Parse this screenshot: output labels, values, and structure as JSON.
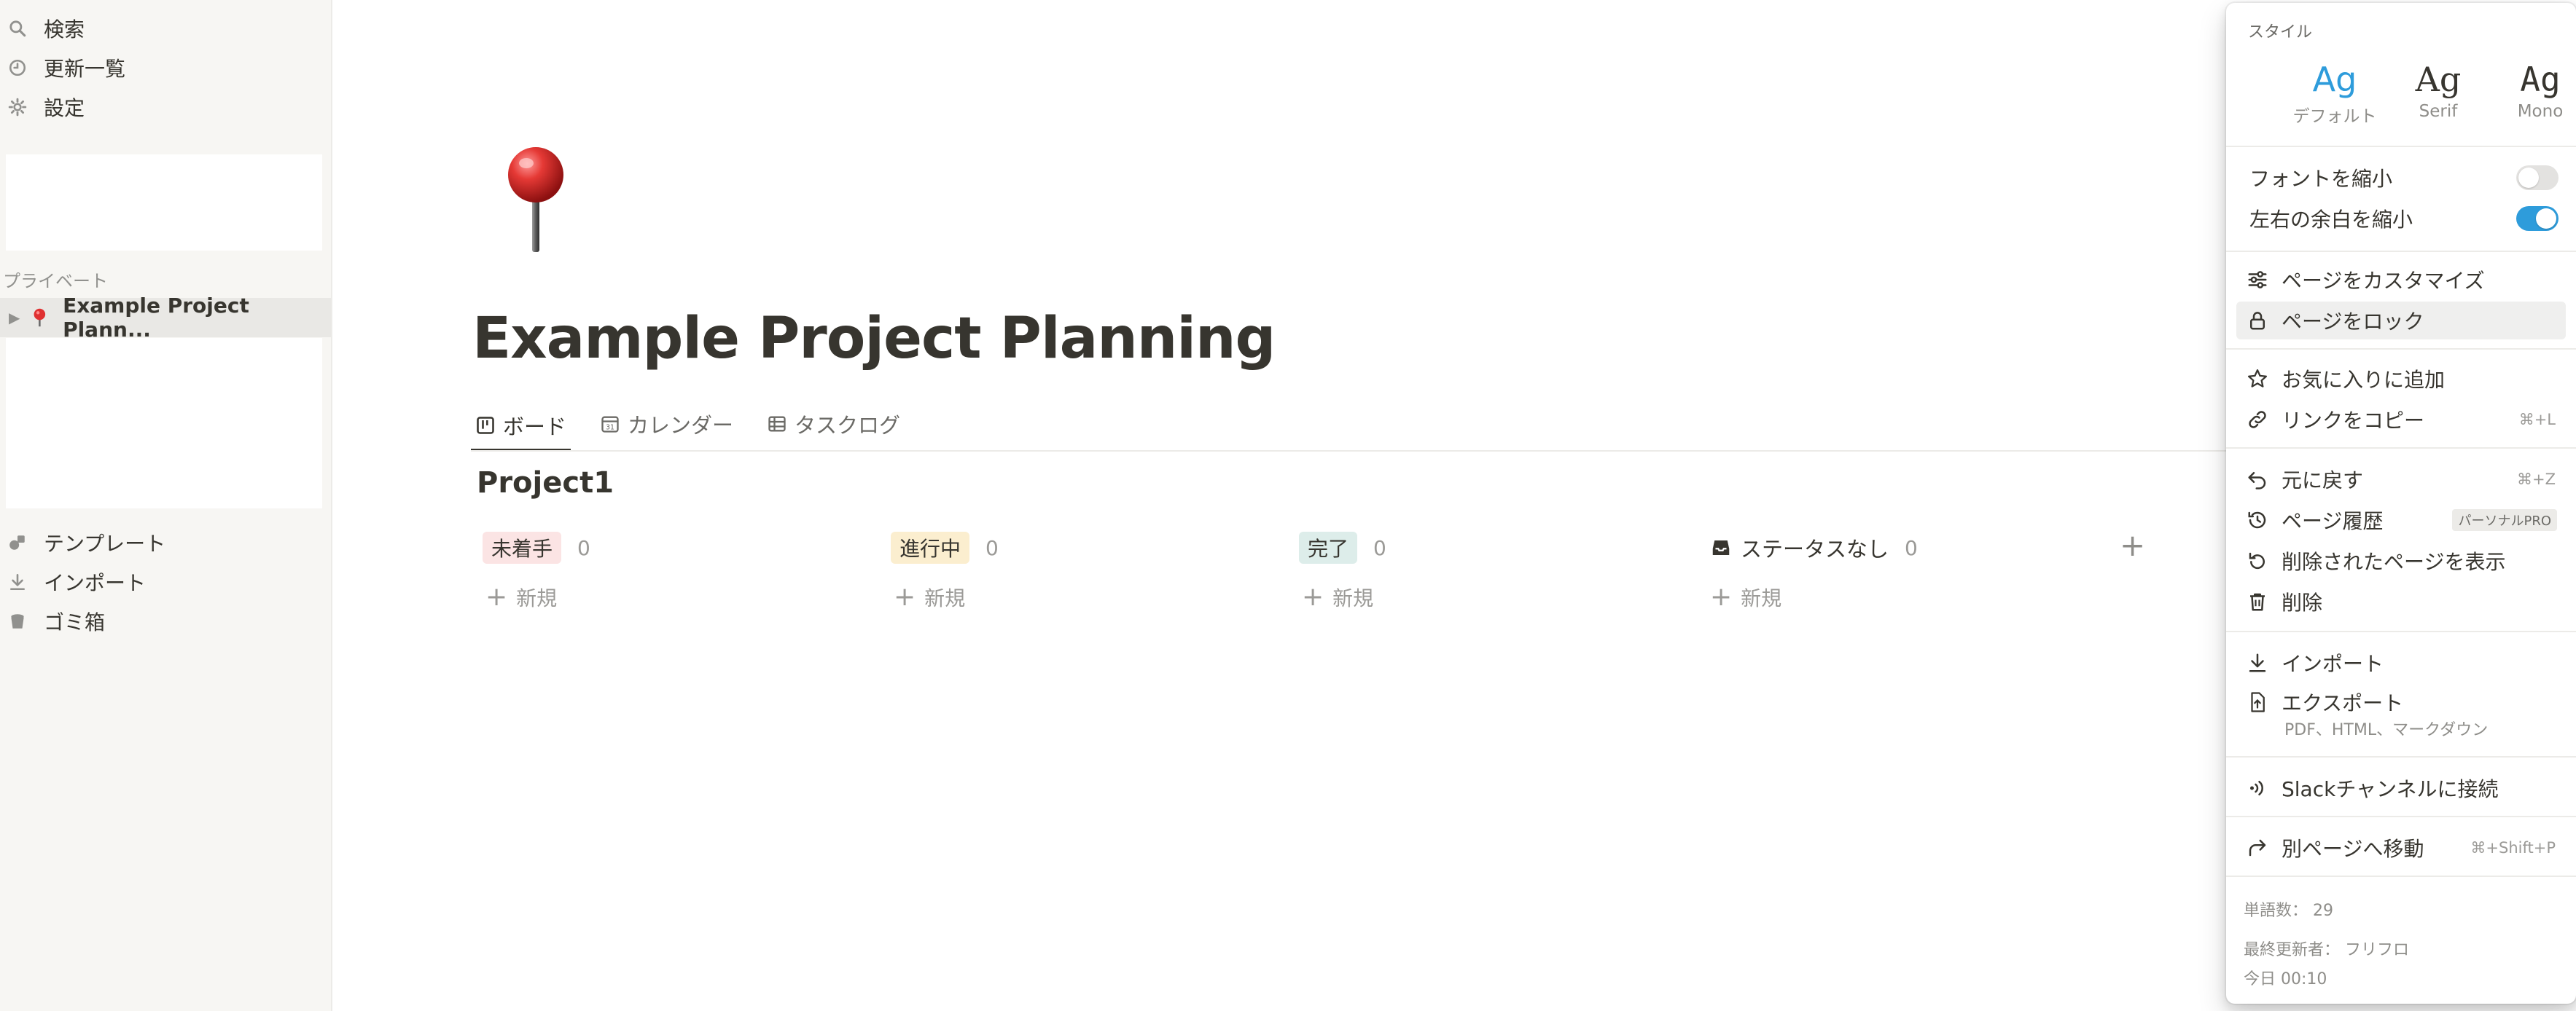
{
  "sidebar": {
    "top_items": [
      {
        "label": "検索",
        "icon": "search-icon"
      },
      {
        "label": "更新一覧",
        "icon": "clock-icon"
      },
      {
        "label": "設定",
        "icon": "gear-icon"
      }
    ],
    "section_label": "プライベート",
    "page": {
      "label": "Example Project Plann...",
      "icon": "pushpin-icon"
    },
    "bottom_items": [
      {
        "label": "テンプレート",
        "icon": "shapes-icon"
      },
      {
        "label": "インポート",
        "icon": "import-icon"
      },
      {
        "label": "ゴミ箱",
        "icon": "trash-icon"
      }
    ]
  },
  "page": {
    "icon": "pushpin-icon",
    "title": "Example Project Planning",
    "tabs": [
      {
        "label": "ボード",
        "icon": "board-icon",
        "active": true
      },
      {
        "label": "カレンダー",
        "icon": "calendar-icon",
        "active": false
      },
      {
        "label": "タスクログ",
        "icon": "table-icon",
        "active": false
      }
    ],
    "group_title": "Project1",
    "columns": [
      {
        "label": "未着手",
        "count": "0",
        "bg": "#fbe4e4",
        "new_label": "新規"
      },
      {
        "label": "進行中",
        "count": "0",
        "bg": "#fbeecf",
        "new_label": "新規"
      },
      {
        "label": "完了",
        "count": "0",
        "bg": "#ddedea",
        "new_label": "新規"
      },
      {
        "label": "ステータスなし",
        "count": "0",
        "icon": "inbox-icon",
        "new_label": "新規"
      }
    ],
    "add_column": "+"
  },
  "menu": {
    "style_label": "スタイル",
    "styles": [
      {
        "sample": "Ag",
        "label": "デフォルト",
        "selected": true
      },
      {
        "sample": "Ag",
        "label": "Serif",
        "selected": false
      },
      {
        "sample": "Ag",
        "label": "Mono",
        "selected": false
      }
    ],
    "toggles": [
      {
        "label": "フォントを縮小",
        "on": false
      },
      {
        "label": "左右の余白を縮小",
        "on": true
      }
    ],
    "items": {
      "customize": {
        "label": "ページをカスタマイズ",
        "icon": "sliders-icon"
      },
      "lock": {
        "label": "ページをロック",
        "icon": "lock-icon"
      },
      "favorite": {
        "label": "お気に入りに追加",
        "icon": "star-icon"
      },
      "copy_link": {
        "label": "リンクをコピー",
        "icon": "link-icon",
        "shortcut": "⌘+L"
      },
      "undo": {
        "label": "元に戻す",
        "icon": "undo-icon",
        "shortcut": "⌘+Z"
      },
      "history": {
        "label": "ページ履歴",
        "icon": "history-icon",
        "badge": "パーソナルPRO"
      },
      "deleted": {
        "label": "削除されたページを表示",
        "icon": "restore-icon"
      },
      "delete": {
        "label": "削除",
        "icon": "trash-icon"
      },
      "import": {
        "label": "インポート",
        "icon": "import-icon"
      },
      "export": {
        "label": "エクスポート",
        "icon": "export-file-icon",
        "sub": "PDF、HTML、マークダウン"
      },
      "slack": {
        "label": "Slackチャンネルに接続",
        "icon": "broadcast-icon"
      },
      "move": {
        "label": "別ページへ移動",
        "icon": "move-arrow-icon",
        "shortcut": "⌘+Shift+P"
      }
    },
    "footer": {
      "word_count": "単語数： 29",
      "last_editor": "最終更新者： フリフロ",
      "time": "今日 00:10"
    }
  }
}
